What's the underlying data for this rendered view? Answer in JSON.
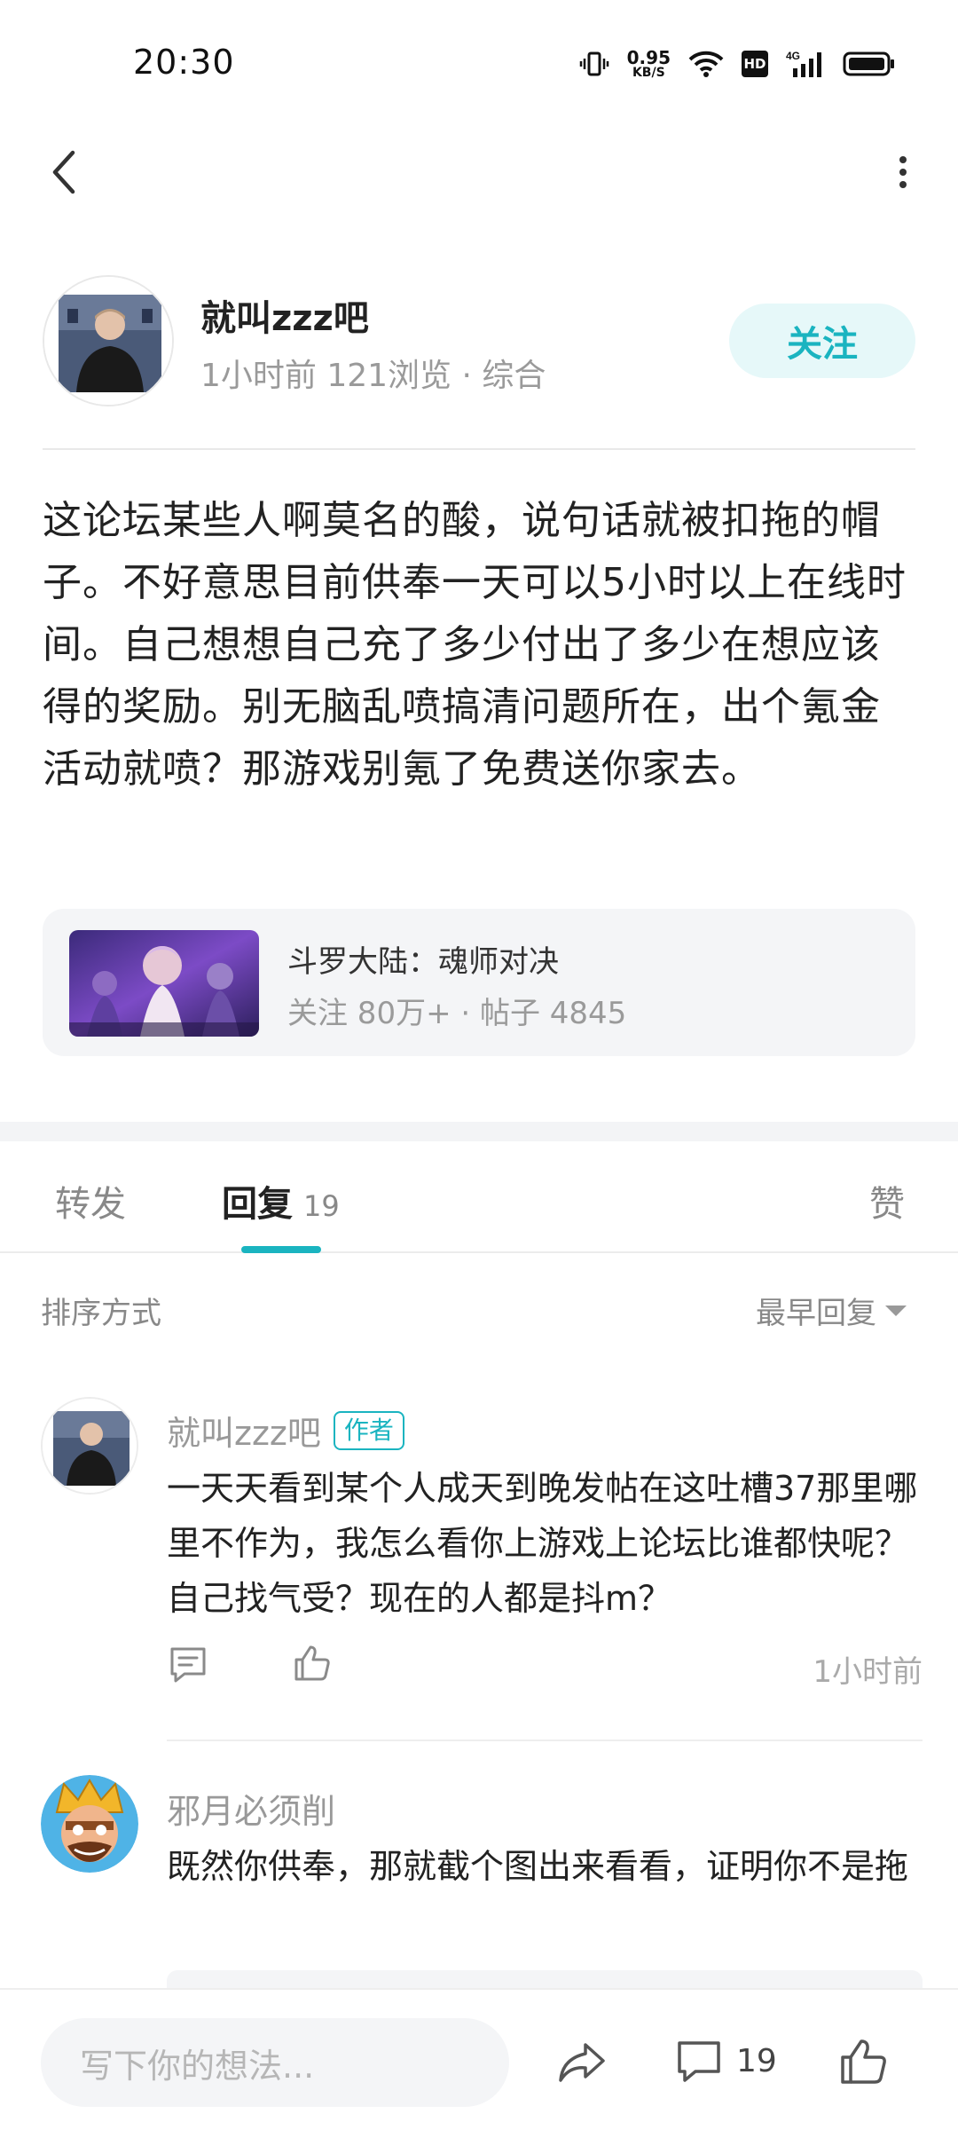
{
  "status_bar": {
    "time": "20:30",
    "net_speed_value": "0.95",
    "net_speed_unit": "KB/S",
    "hd": "HD",
    "signal": "4G",
    "icons": [
      "vibrate-icon",
      "wifi-icon",
      "hd-icon",
      "signal-icon",
      "battery-icon"
    ]
  },
  "nav": {
    "back_icon": "chevron-left-icon",
    "more_icon": "more-vertical-icon"
  },
  "post": {
    "author_name": "就叫zzz吧",
    "meta": "1小时前  121浏览 · 综合",
    "follow_label": "关注",
    "body": "这论坛某些人啊莫名的酸，说句话就被扣拖的帽子。不好意思目前供奉一天可以5小时以上在线时间。自己想想自己充了多少付出了多少在想应该得的奖励。别无脑乱喷搞清问题所在，出个氪金活动就喷？那游戏别氪了免费送你家去。"
  },
  "game_card": {
    "name": "斗罗大陆：魂师对决",
    "stats": "关注 80万+ · 帖子 4845"
  },
  "tabs": {
    "forward": "转发",
    "reply": "回复",
    "reply_count": "19",
    "like": "赞"
  },
  "sort": {
    "label": "排序方式",
    "value": "最早回复"
  },
  "comments": [
    {
      "name": "就叫zzz吧",
      "badge": "作者",
      "text": "一天天看到某个人成天到晚发帖在这吐槽37那里哪里不作为，我怎么看你上游戏上论坛比谁都快呢？自己找气受？现在的人都是抖m？",
      "time": "1小时前"
    },
    {
      "name": "邪月必须削",
      "text": "既然你供奉，那就截个图出来看看，证明你不是拖"
    }
  ],
  "bottom_bar": {
    "input_placeholder": "写下你的想法...",
    "comment_count": "19"
  },
  "colors": {
    "accent": "#1ab4c0",
    "follow_bg": "#e6f8f9",
    "card_bg": "#f4f5f7"
  }
}
